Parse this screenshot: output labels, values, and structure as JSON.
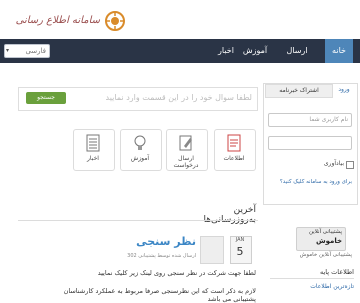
{
  "header": {
    "logo_text": "سامانه اطلاع رسانی"
  },
  "nav": {
    "items": [
      {
        "label": "خانه"
      },
      {
        "label": "ارسال درخواست"
      },
      {
        "label": "آموزش"
      },
      {
        "label": "اخبار"
      }
    ],
    "search_label": "فارسی"
  },
  "login": {
    "tab_login": "ورود",
    "tab_subscription": "اشتراک خبرنامه",
    "username_placeholder": "نام کاربری شما",
    "password_placeholder": "",
    "captcha_placeholder": "",
    "remember_label": "بیادآوری",
    "forgot_text": "برای ورود به سامانه کلیک کنید؟"
  },
  "support": {
    "line1": "پشتیبانی آنلاین",
    "line2": "خاموش",
    "under_text": "پشتیبانی آنلاین خاموش"
  },
  "info": {
    "title": "اطلاعات پایه",
    "link": "تازه‌ترین اطلاعات"
  },
  "question": {
    "placeholder": "لطفا سوال خود را در این قسمت وارد نمایید",
    "button_label": "جستجو"
  },
  "tiles": [
    {
      "label": "اطلاعات"
    },
    {
      "label": "ارسال درخواست"
    },
    {
      "label": "آموزش"
    },
    {
      "label": "اخبار"
    }
  ],
  "news": {
    "section_title": "آخرین به‌روزرسانی‌ها",
    "date_month": "JAN",
    "date_day": "5",
    "post_title": "نظر سنجی",
    "post_meta": "ارسال شده توسط پشتیبانی 302",
    "body_line1": "لطفا جهت شرکت در نظر سنجی روی لینک زیر کلیک نمایید",
    "body_line2": "لازم به ذکر است که این نظرسنجی صرفا مربوط به عملکرد کارشناسان پشتیبانی می باشد"
  },
  "colors": {
    "nav_bg": "#2a3446",
    "nav_active": "#4e86b9",
    "accent_green": "#6aa03c",
    "link_blue": "#2f6aa8"
  }
}
